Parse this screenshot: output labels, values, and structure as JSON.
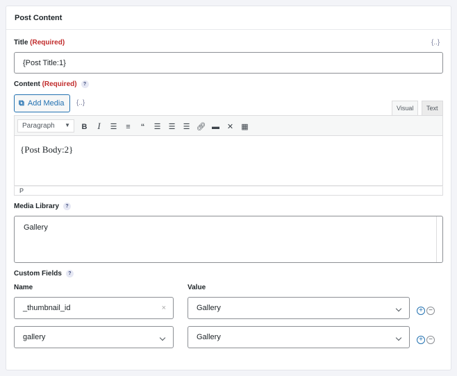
{
  "header": {
    "title": "Post Content"
  },
  "title_field": {
    "label": "Title",
    "required": "(Required)",
    "merge_tag": "{..}",
    "value": "{Post Title:1}"
  },
  "content_field": {
    "label": "Content",
    "required": "(Required)",
    "help": "?",
    "add_media": "Add Media",
    "merge_tag": "{..}",
    "tabs": [
      "Visual",
      "Text"
    ],
    "format_select": "Paragraph",
    "body": "{Post Body:2}",
    "status_path": "P"
  },
  "media_library": {
    "label": "Media Library",
    "help": "?",
    "value": "Gallery"
  },
  "custom_fields": {
    "label": "Custom Fields",
    "help": "?",
    "name_header": "Name",
    "value_header": "Value",
    "rows": [
      {
        "name": "_thumbnail_id",
        "value": "Gallery"
      },
      {
        "name": "gallery",
        "value": "Gallery"
      }
    ],
    "add": "+",
    "remove": "−"
  }
}
